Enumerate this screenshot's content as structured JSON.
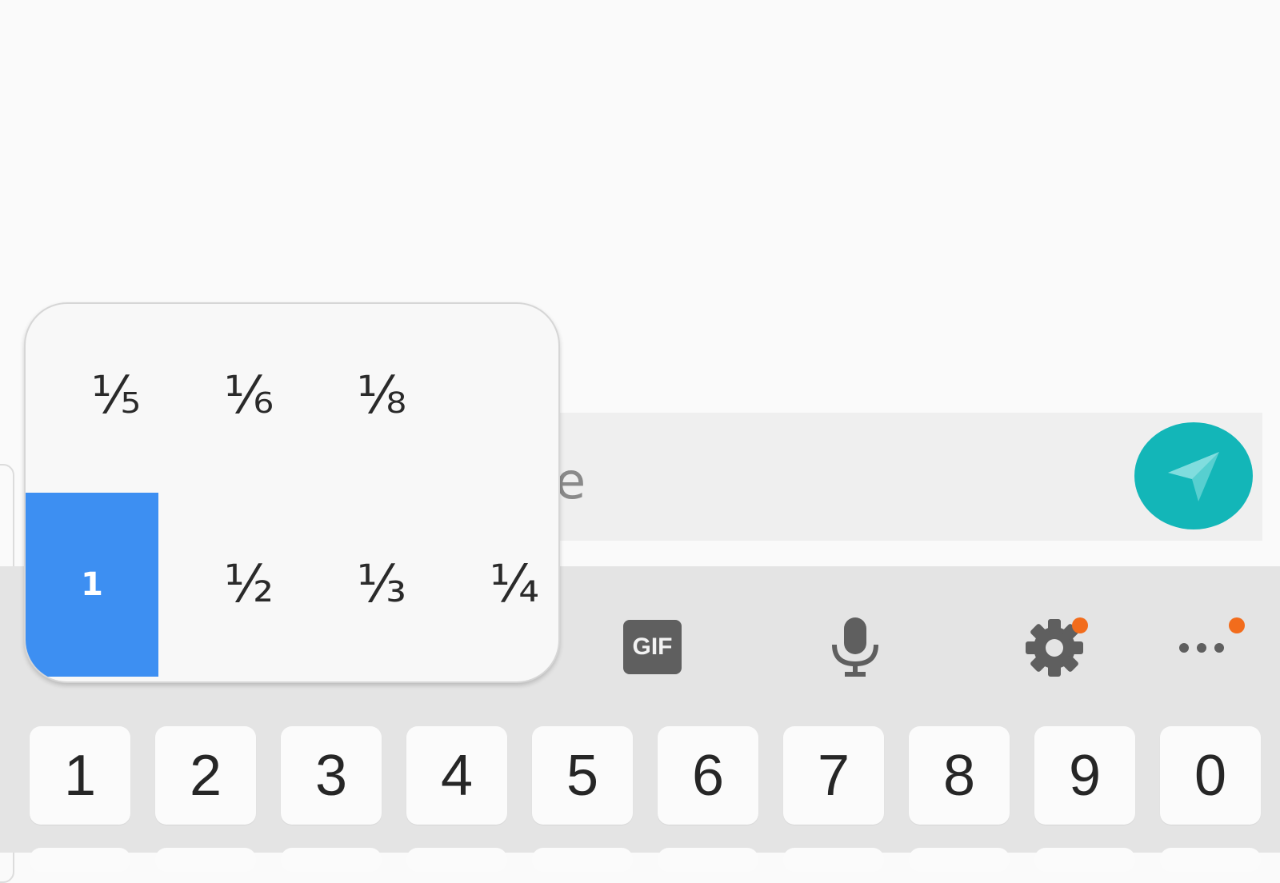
{
  "compose": {
    "hint_fragment": "e",
    "send_icon": "send-icon",
    "send_color": "#13b6b8"
  },
  "toolbar": {
    "gif_label": "GIF",
    "mic_icon": "microphone-icon",
    "settings_icon": "gear-icon",
    "more_icon": "more-icon",
    "badge_color": "#f26c1c"
  },
  "popup": {
    "selected_color": "#3d8ff2",
    "row1": [
      "⅕",
      "⅙",
      "⅛"
    ],
    "row2": [
      "1",
      "½",
      "⅓",
      "¼"
    ],
    "selected": "1"
  },
  "number_row": [
    "1",
    "2",
    "3",
    "4",
    "5",
    "6",
    "7",
    "8",
    "9",
    "0"
  ]
}
